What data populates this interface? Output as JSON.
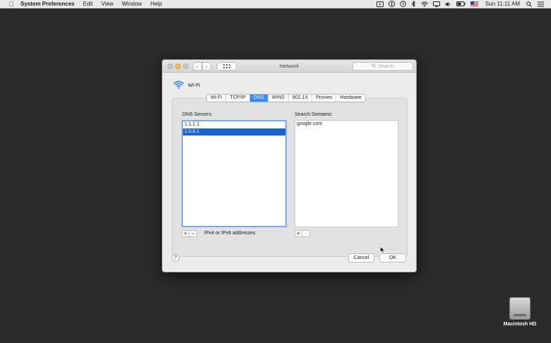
{
  "menubar": {
    "app_name": "System Preferences",
    "menus": [
      "Edit",
      "View",
      "Window",
      "Help"
    ],
    "clock": "Sun 11:11 AM"
  },
  "window": {
    "title": "Network",
    "search_placeholder": "Search",
    "interface_name": "Wi-Fi",
    "tabs": [
      "Wi-Fi",
      "TCP/IP",
      "DNS",
      "WINS",
      "802.1X",
      "Proxies",
      "Hardware"
    ],
    "active_tab": "DNS",
    "dns": {
      "label": "DNS Servers:",
      "servers": [
        "1.1.1.1",
        "1.0.0.1"
      ],
      "selected_index": 1,
      "hint": "IPv4 or IPv6 addresses"
    },
    "domains": {
      "label": "Search Domains:",
      "items": [
        "google.com"
      ]
    },
    "buttons": {
      "cancel": "Cancel",
      "ok": "OK",
      "help": "?",
      "add": "+",
      "remove": "−"
    }
  },
  "desktop": {
    "disk_label": "Macintosh HD"
  },
  "colors": {
    "accent": "#3b8af2",
    "selection": "#1b63d0",
    "desktop": "#2b2b2b"
  }
}
